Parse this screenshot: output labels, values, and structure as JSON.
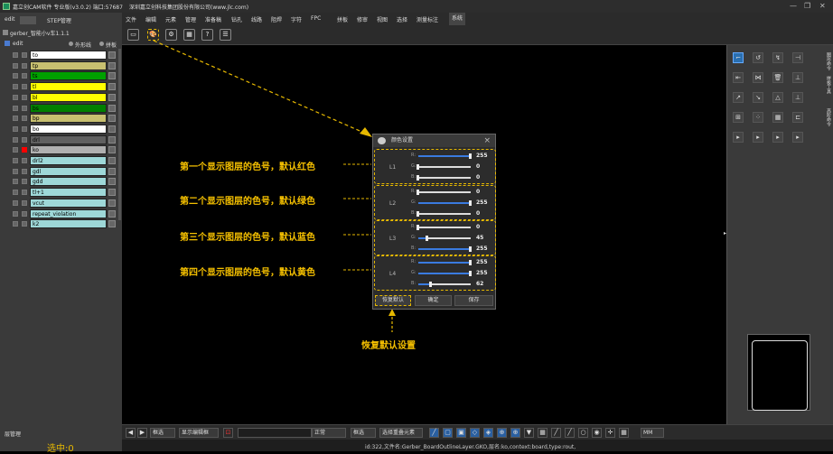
{
  "titlebar": {
    "app_icon": "app-logo-icon",
    "title": "嘉立创CAM软件 专业版(v3.0.2) 端口:57687",
    "company": "深圳嘉立创科技集团股份有限公司(www.jlc.com)",
    "minimize": "—",
    "restore": "❐",
    "close": "✕"
  },
  "left_panel": {
    "tab_edit": "edit",
    "tab_step": "STEP管理",
    "job_name": "gerber_智能小v车1.1.1",
    "edit_label": "edit",
    "outline_label": "外形线",
    "panel_label": "拼板",
    "layers": [
      {
        "name": "to",
        "color": "#ffffff"
      },
      {
        "name": "tp",
        "color": "#c8c070"
      },
      {
        "name": "ts",
        "color": "#00a000"
      },
      {
        "name": "tl",
        "color": "#ffff00"
      },
      {
        "name": "bl",
        "color": "#ffff00"
      },
      {
        "name": "bs",
        "color": "#008000"
      },
      {
        "name": "bp",
        "color": "#c8c070"
      },
      {
        "name": "bo",
        "color": "#ffffff"
      },
      {
        "name": "drl",
        "color": "#606060"
      },
      {
        "name": "ko",
        "color": "#b0b0b0"
      },
      {
        "name": "drl2",
        "color": "#9ed8d8"
      },
      {
        "name": "gdl",
        "color": "#9ed8d8"
      },
      {
        "name": "gdd",
        "color": "#9ed8d8"
      },
      {
        "name": "tl+1",
        "color": "#9ed8d8"
      },
      {
        "name": "vcut",
        "color": "#9ed8d8"
      },
      {
        "name": "repeat_violation",
        "color": "#9ed8d8"
      },
      {
        "name": "k2",
        "color": "#9ed8d8"
      }
    ],
    "layer_mgmt": "层管理",
    "selected": "选中:0"
  },
  "menubar": {
    "items": [
      "文件",
      "编辑",
      "元素",
      "管理",
      "准备稿",
      "钻孔",
      "线路",
      "阻焊",
      "字符",
      "FPC",
      "拼板",
      "修审",
      "视图",
      "选择",
      "测量标注",
      "系统"
    ],
    "active_index": 15
  },
  "dialog": {
    "title": "颜色设置",
    "close": "×",
    "groups": [
      {
        "label": "L1",
        "r": "255",
        "g": "0",
        "b": "0"
      },
      {
        "label": "L2",
        "r": "0",
        "g": "255",
        "b": "0"
      },
      {
        "label": "L3",
        "r": "0",
        "g": "45",
        "b": "255"
      },
      {
        "label": "L4",
        "r": "255",
        "g": "255",
        "b": "62"
      }
    ],
    "reset": "恢复默认",
    "apply": "确定",
    "save": "保存"
  },
  "annotations": {
    "l1": "第一个显示图层的色号，默认红色",
    "l2": "第二个显示图层的色号，默认绿色",
    "l3": "第三个显示图层的色号，默认蓝色",
    "l4": "第四个显示图层的色号，默认黄色",
    "reset": "恢复默认设置"
  },
  "right_panel": {
    "side_labels": [
      "图形命令",
      "拼板工具",
      "高阶命令"
    ]
  },
  "bottombar": {
    "mode": "框选",
    "display_btn": "显示编辑框",
    "normal": "正常",
    "snap": "框选",
    "snap2": "选择重叠元素",
    "unit": "MM"
  },
  "statusbar": {
    "text": "id:322,文件名:Gerber_BoardOutlineLayer.GKO,层名:ko,context:board,type:rout,"
  },
  "colors": {
    "accent": "#e6b800",
    "highlight_layer": "#ff0000"
  }
}
